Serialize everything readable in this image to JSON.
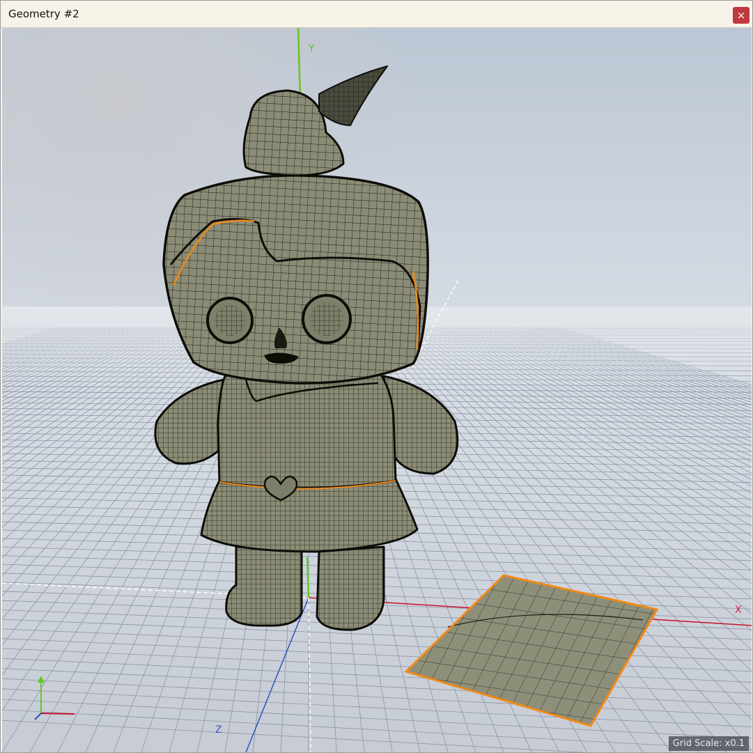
{
  "window": {
    "title": "Geometry #2",
    "close_glyph": "×"
  },
  "viewport": {
    "axis_labels": {
      "x": "X",
      "y": "Y",
      "z": "Z"
    },
    "grid_scale": "Grid Scale: x0.1",
    "colors": {
      "x_axis": "#c8102e",
      "y_axis": "#62c81e",
      "z_axis": "#2a52be",
      "mesh_fill": "#8b8c76",
      "selection": "#f08a17",
      "wire": "#16160f"
    }
  },
  "scene": {
    "objects": [
      "doll-mesh",
      "plane-patch"
    ],
    "gizmo_icon": "orientation-gizmo-icon"
  }
}
